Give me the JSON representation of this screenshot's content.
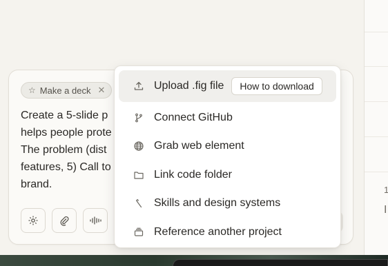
{
  "composer": {
    "chip_label": "Make a deck",
    "prompt_text": "Create a 5-slide p\nhelps people prote\nThe problem (dist\nfeatures, 5) Call to\nbrand."
  },
  "menu": {
    "items": [
      {
        "label": "Upload .fig file",
        "icon": "upload-icon"
      },
      {
        "label": "Connect GitHub",
        "icon": "git-branch-icon"
      },
      {
        "label": "Grab web element",
        "icon": "globe-icon"
      },
      {
        "label": "Link code folder",
        "icon": "folder-icon"
      },
      {
        "label": "Skills and design systems",
        "icon": "wrench-icon"
      },
      {
        "label": "Reference another project",
        "icon": "stack-icon"
      }
    ],
    "how_to_download_label": "How to download"
  },
  "right_pane": {
    "glyph_1": "1",
    "glyph_2": "I"
  }
}
